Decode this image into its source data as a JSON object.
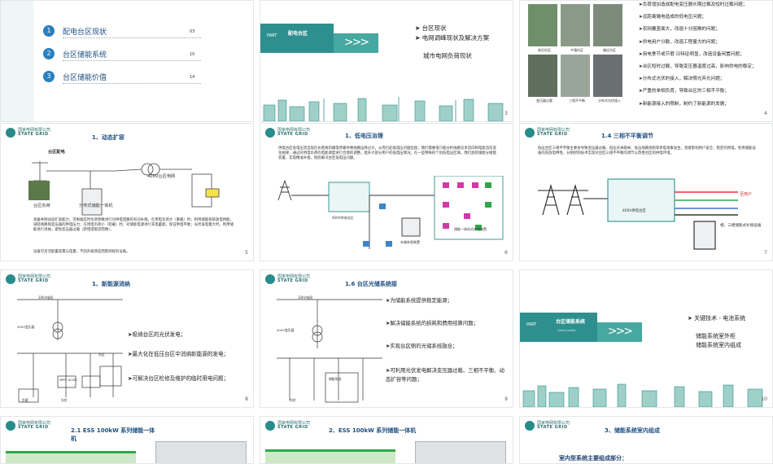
{
  "colors": {
    "teal": "#2f8f8f",
    "dark_blue": "#1e4f80",
    "accent_green": "#2ea84a"
  },
  "slide1": {
    "items": [
      {
        "num": "1",
        "label": "配电台区现状",
        "page": "03"
      },
      {
        "num": "2",
        "label": "台区储能系统",
        "page": "10"
      },
      {
        "num": "3",
        "label": "台区储能价值",
        "page": "14"
      }
    ]
  },
  "slide2": {
    "part": "PART",
    "title": "配电台区",
    "bullets": [
      "台区现状",
      "电网调峰现状及解决方案",
      "城市电网负荷现状"
    ],
    "page": "3"
  },
  "slide3": {
    "photo_labels": [
      "老旧台区",
      "乡镇台区",
      "偏远台区",
      "变压器过载",
      "三相不平衡",
      "分布式光伏接入"
    ],
    "bullets": [
      "负荷增加造成配电变压器长期过载及短时过载问题；",
      "远距离输电造成的低电压问题；",
      "农网覆盖面大，改造十分困难的问题；",
      "供电用户分散，改造工程量大的问题；",
      "用电季节或节假 日特征明显，改造设备闲置问题；",
      "台区短时过载，导致变压器温度过高，影响供电的稳定；",
      "分布式光伏的接入，解决限光弃光问题；",
      "严重的单相负荷，导致台区的三相不平衡；",
      "新能源接入的限制，制约了新能源的发展；"
    ],
    "page": "4"
  },
  "header": {
    "company_cn": "国家电网有限公司",
    "company_en": "STATE GRID"
  },
  "slide4": {
    "title": "1、动态扩容",
    "labels": [
      "台区配电",
      "台区负荷",
      "分布式储能一体机",
      "400V台区电网"
    ],
    "body": "    具备并网动态扩容能力，可根据实时负荷参数进行对供电回路的有功补偿。在用电负荷大（重载）时，利用储能系统放电供能，减轻线路和变压器的供电压力；在用电负荷小（轻载）时，对储能电源进行充电蓄能，保证供电平衡；光伏发电量大时，利用储能进行消纳，避免变压器过载（新增或限流而致）。",
    "note": "    设备可灵活配置容量与电量，不因升级改造而影响现有设备。",
    "page": "5"
  },
  "slide5": {
    "title": "1、低电压治理",
    "body": "    供电台区低电压常出现在长距离的输电传输导致线路压降过大，从而引起低电压问题出现，我们需要很只能分析线路功率流向和电能流向变化规律，通过对用电负荷的电能调度进行合理的调整，提升大部分用户的低电压情况；在一些特殊的个别低电压区域，我们加装储能分储能装置，实现精准补偿，彻底解决台区低电压问题。",
    "labels": [
      "400V供电台区",
      "储能一体机式补偿装置",
      "末端补偿装置"
    ],
    "page": "6"
  },
  "slide6": {
    "title": "1.4 三相不平衡调节",
    "body": "    低压台区三相不平衡主要会导致变压器过载、低压开关跳闸、低压线路烧损等停电现象发生，直接影响用户安全、稳定的用电。利用储能设备的充放电特性，分相控制技术实现对台区三相不平衡的调节以改善台区的供电环境。",
    "labels": [
      "400V供电台区",
      "至用户",
      "相、三相储能式补偿设备"
    ],
    "page": "7"
  },
  "slide7": {
    "title": "1、新能源消纳",
    "bullets": [
      "吸纳台区的光伏发电；",
      "最大化在低压台区中消纳新能源的发电；",
      "可解决台区检修及维护的临时用电问题；"
    ],
    "diagram_labels": [
      "10kV电网",
      "400V变压器",
      "台区",
      "MPPT AC/DC",
      "负载",
      "光伏"
    ],
    "page": "8"
  },
  "slide8": {
    "title": "1.6 台区光储系统接",
    "bullets": [
      "为储能系统提供稳定能源；",
      "解决储能系统的损耗和费用结算问题；",
      "实现台区侧的光储系统融合；",
      "可利用光伏发电解决变压器过载、三相不平衡、动态扩容等问题；"
    ],
    "diagram_labels": [
      "10kV电网",
      "400V变压器",
      "储能系统",
      "光伏"
    ],
    "page": "9"
  },
  "slide9": {
    "part": "PART",
    "title": "台区储能系统",
    "subtitle": "Lorem public",
    "bullets": [
      "关键技术 - 电池系统",
      "储能系统室外柜",
      "储能系统室内组成"
    ],
    "page": "10"
  },
  "slide10": {
    "title": "2.1 ESS 100kW 系列储能一体机"
  },
  "slide11": {
    "title": "2、ESS 100kW 系列储能一体机"
  },
  "slide12": {
    "title": "3、储能系统室内组成",
    "subtitle": "室内型系统主要组成部分："
  }
}
